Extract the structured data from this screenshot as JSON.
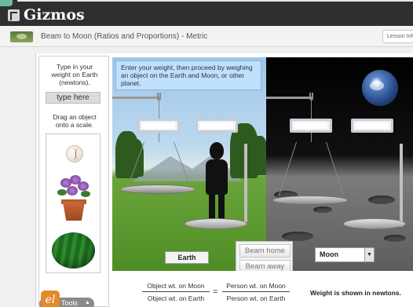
{
  "app": {
    "brand": "Gizmos"
  },
  "gizmo": {
    "title": "Beam to Moon (Ratios and Proportions) - Metric",
    "lesson_info": "Lesson Info"
  },
  "left_panel": {
    "instruction": "Type in your weight on Earth (newtons).",
    "weight_placeholder": "type here",
    "drag_instruction": "Drag an object onto a scale.",
    "objects": [
      "baseball",
      "potted-plant",
      "watermelon"
    ],
    "tools_label": "Tools"
  },
  "earth": {
    "instruction": "Enter your weight, then proceed by weighing an object on the Earth and Moon, or other planet.",
    "label": "Earth"
  },
  "moon": {
    "select_value": "Moon"
  },
  "buttons": {
    "beam_home": "Beam home",
    "beam_away": "Beam away"
  },
  "formula": {
    "object_num": "Object wt. on Moon",
    "object_den": "Object wt. on Earth",
    "equals": "=",
    "person_num": "Person wt. on Moon",
    "person_den": "Person wt. on Earth",
    "note": "Weight is shown in newtons."
  }
}
